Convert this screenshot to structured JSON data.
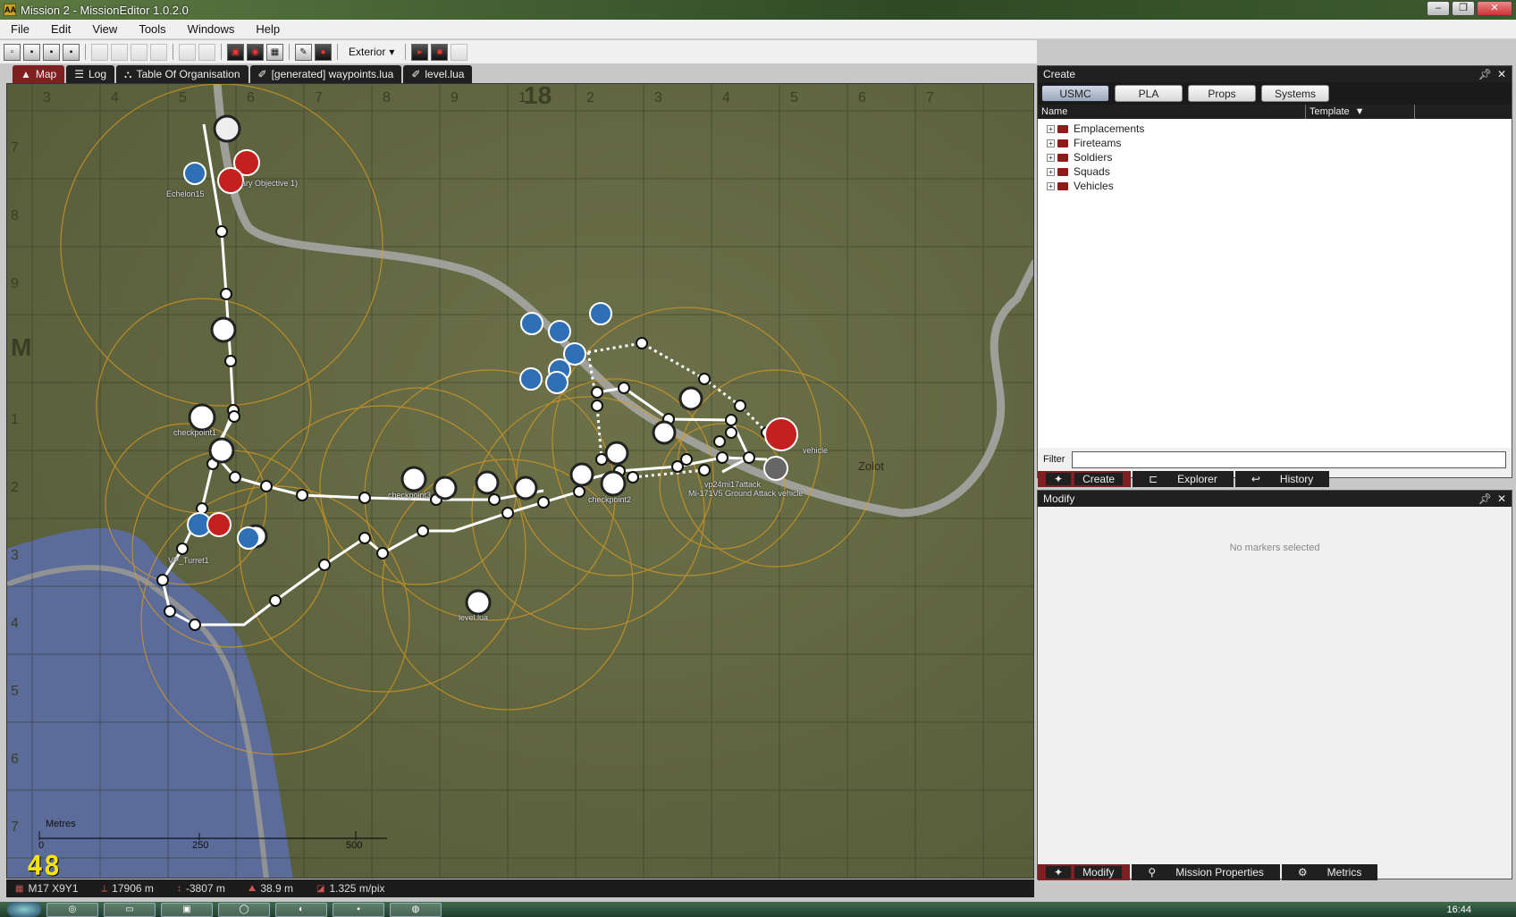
{
  "window": {
    "title": "Mission 2 - MissionEditor 1.0.2.0",
    "app_icon": "aa-icon"
  },
  "menu": [
    "File",
    "Edit",
    "View",
    "Tools",
    "Windows",
    "Help"
  ],
  "toolbar": {
    "view_mode": "Exterior"
  },
  "doc_tabs": [
    {
      "label": "Map",
      "icon": "map-icon",
      "active": true
    },
    {
      "label": "Log",
      "icon": "list-icon",
      "active": false
    },
    {
      "label": "Table Of Organisation",
      "icon": "hierarchy-icon",
      "active": false
    },
    {
      "label": "[generated] waypoints.lua",
      "icon": "script-icon",
      "active": false
    },
    {
      "label": "level.lua",
      "icon": "script-icon",
      "active": false
    }
  ],
  "map": {
    "grid_big_label": "18",
    "grid_col_labels": [
      "3",
      "4",
      "5",
      "6",
      "7",
      "8",
      "9",
      "1",
      "2",
      "3",
      "4",
      "5",
      "6",
      "7"
    ],
    "grid_row_labels": [
      "7",
      "8",
      "9",
      "M",
      "1",
      "2",
      "3",
      "4",
      "5",
      "6",
      "7"
    ],
    "zoom_level": "48",
    "scale": {
      "title": "Metres",
      "ticks": [
        "0",
        "250",
        "500"
      ]
    },
    "labels": {
      "echelon": "Echelon15",
      "objective": "ary Objective 1)",
      "checkpoint1": "checkpoint1",
      "checkpoint2": "checkpoint2",
      "checkpoint3": "checkpoint3",
      "level": "level.lua",
      "town": "Zolot",
      "attack": "vp24mi17attack",
      "heli": "Mi-171V5 Ground Attack vehicle",
      "vehicle": "vehicle",
      "turret": "VP_Turret1"
    }
  },
  "status": {
    "grid": "M17 X9Y1",
    "easting": "17906 m",
    "northing": "-3807 m",
    "altitude": "38.9 m",
    "resolution": "1.325 m/pix"
  },
  "create_panel": {
    "title": "Create",
    "factions": [
      "USMC",
      "PLA",
      "Props",
      "Systems"
    ],
    "selected_faction": "USMC",
    "columns": {
      "name": "Name",
      "template": "Template"
    },
    "tree": [
      "Emplacements",
      "Fireteams",
      "Soldiers",
      "Squads",
      "Vehicles"
    ],
    "filter_label": "Filter",
    "filter_value": "",
    "tabs": [
      {
        "label": "Create",
        "active": true
      },
      {
        "label": "Explorer",
        "active": false
      },
      {
        "label": "History",
        "active": false
      }
    ]
  },
  "modify_panel": {
    "title": "Modify",
    "empty_message": "No markers selected",
    "tabs": [
      {
        "label": "Modify",
        "active": true
      },
      {
        "label": "Mission Properties",
        "active": false
      },
      {
        "label": "Metrics",
        "active": false
      }
    ]
  },
  "taskbar": {
    "clock": "16:44"
  },
  "colors": {
    "accent_red": "#7e2020",
    "dark_header": "#202020",
    "zoom_yellow": "#f5e30c",
    "blue_unit": "#2f6fb5",
    "red_unit": "#c42020"
  }
}
